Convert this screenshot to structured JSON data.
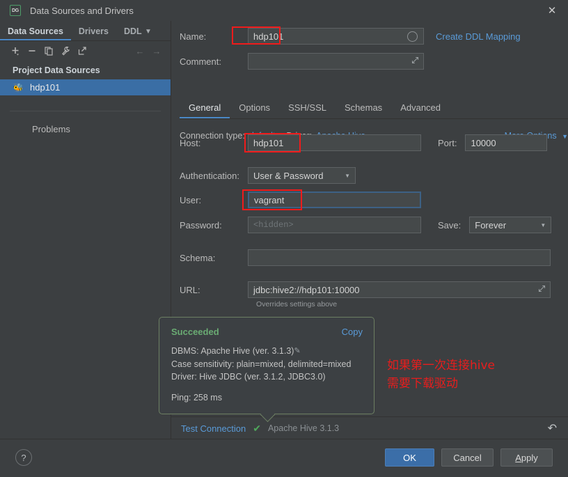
{
  "window": {
    "title": "Data Sources and Drivers",
    "app_icon": "DG",
    "close_icon": "close-icon"
  },
  "sidebar": {
    "tabs": [
      {
        "label": "Data Sources",
        "active": true
      },
      {
        "label": "Drivers",
        "active": false
      },
      {
        "label": "DDL",
        "active": false
      }
    ],
    "overflow_icon": "chevron-down-icon",
    "toolbar": [
      {
        "name": "add-icon",
        "glyph": "+"
      },
      {
        "name": "remove-icon",
        "glyph": "−"
      },
      {
        "name": "copy-icon",
        "glyph": "❐"
      },
      {
        "name": "wrench-icon",
        "glyph": "ὒ7"
      },
      {
        "name": "external-link-icon",
        "glyph": "↗"
      },
      {
        "name": "back-arrow-icon",
        "glyph": "←"
      },
      {
        "name": "forward-arrow-icon",
        "glyph": "→"
      }
    ],
    "section_title": "Project Data Sources",
    "data_source": {
      "name": "hdp101",
      "icon": "hive-icon",
      "selected": true
    },
    "problems_label": "Problems"
  },
  "form": {
    "name_label": "Name:",
    "name_value": "hdp101",
    "create_ddl_link": "Create DDL Mapping",
    "comment_label": "Comment:",
    "comment_value": "",
    "tabs": [
      {
        "label": "General",
        "active": true
      },
      {
        "label": "Options",
        "active": false
      },
      {
        "label": "SSH/SSL",
        "active": false
      },
      {
        "label": "Schemas",
        "active": false
      },
      {
        "label": "Advanced",
        "active": false
      }
    ],
    "connection_type_label": "Connection type:",
    "connection_type_value": "default",
    "driver_label": "Driver:",
    "driver_value": "Apache Hive",
    "more_options": "More Options",
    "host_label": "Host:",
    "host_value": "hdp101",
    "port_label": "Port:",
    "port_value": "10000",
    "auth_label": "Authentication:",
    "auth_value": "User & Password",
    "user_label": "User:",
    "user_value": "vagrant",
    "password_label": "Password:",
    "password_placeholder": "<hidden>",
    "save_label": "Save:",
    "save_value": "Forever",
    "schema_label": "Schema:",
    "schema_value": "",
    "url_label": "URL:",
    "url_value": "jdbc:hive2://hdp101:10000",
    "url_hint": "Overrides settings above"
  },
  "tooltip": {
    "status": "Succeeded",
    "copy_label": "Copy",
    "line_dbms": "DBMS: Apache Hive (ver. 3.1.3)",
    "line_case": "Case sensitivity: plain=mixed, delimited=mixed",
    "line_driver": "Driver: Hive JDBC (ver. 3.1.2, JDBC3.0)",
    "ping": "Ping: 258 ms",
    "edit_icon": "pencil-icon"
  },
  "annotation": {
    "line1": "如果第一次连接hive",
    "line2": "需要下载驱动",
    "color": "#e81d1d"
  },
  "test_bar": {
    "test_link": "Test Connection",
    "check_icon": "check-icon",
    "driver_text": "Apache Hive 3.1.3",
    "revert_icon": "revert-icon"
  },
  "footer": {
    "help_label": "?",
    "ok_label": "OK",
    "cancel_label": "Cancel",
    "apply_label_underline": "A",
    "apply_label_rest": "pply"
  },
  "colors": {
    "accent_blue": "#4a88c7",
    "link_blue": "#5a9bd8",
    "success_green": "#6aab73",
    "annotation_red": "#e81d1d",
    "selection_blue": "#3a6ea5",
    "panel_bg": "#3c3f41"
  }
}
